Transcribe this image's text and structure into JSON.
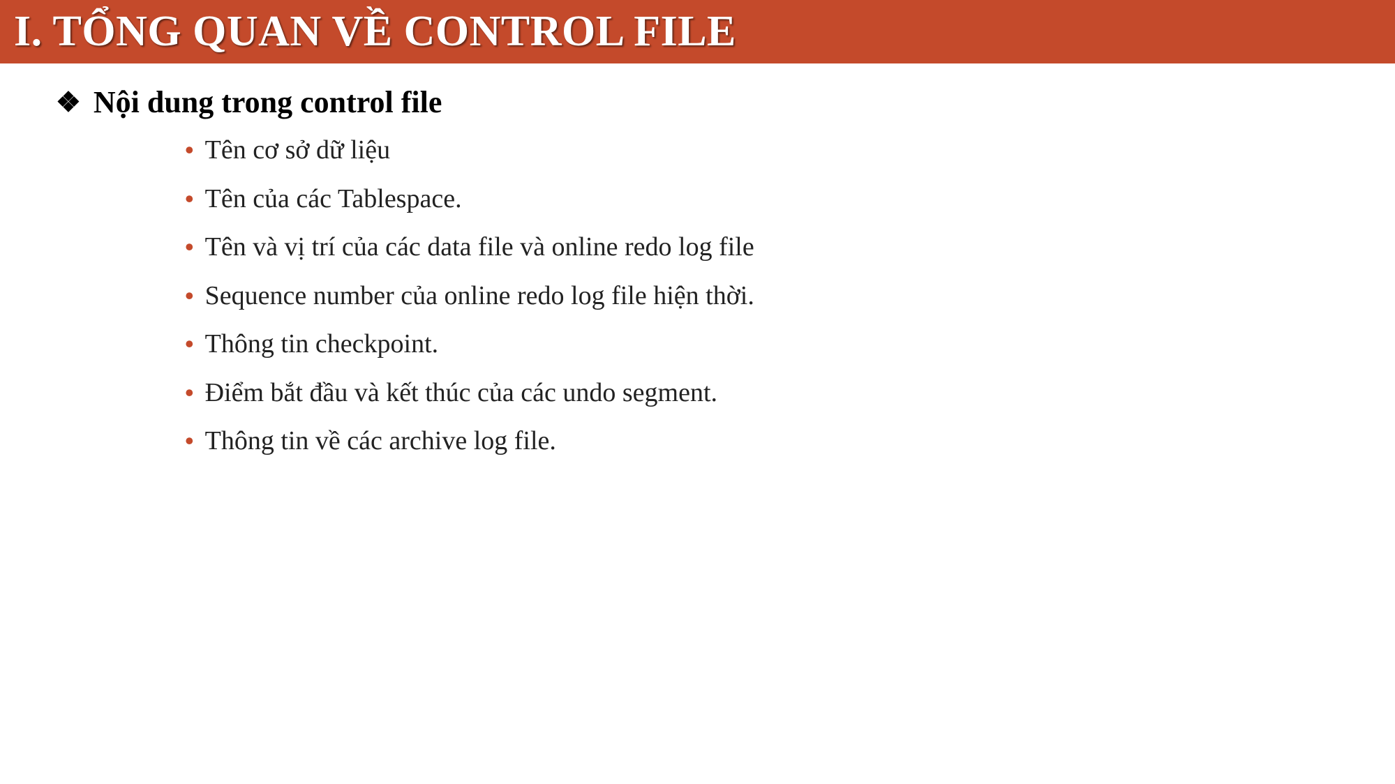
{
  "slide": {
    "title": "I. TỔNG QUAN VỀ CONTROL FILE",
    "subtitle": "Nội dung trong control file",
    "bullets": [
      "Tên cơ sở dữ liệu",
      "Tên của các Tablespace.",
      "Tên và vị trí của các data file và online redo log file",
      "Sequence number của online redo log file hiện thời.",
      "Thông tin checkpoint.",
      "Điểm bắt đầu và kết thúc của các undo segment.",
      "Thông tin về các archive log file."
    ]
  }
}
